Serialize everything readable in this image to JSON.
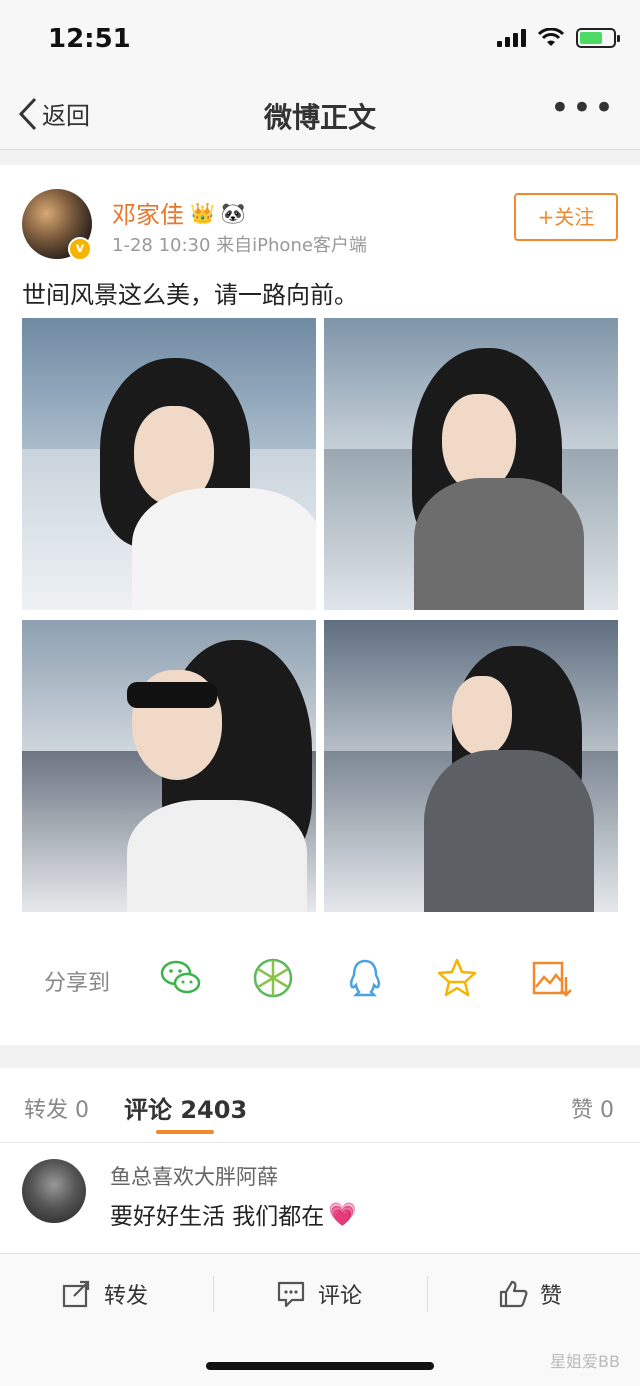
{
  "status_bar": {
    "time": "12:51"
  },
  "nav": {
    "back_label": "返回",
    "title": "微博正文",
    "more_label": "•••"
  },
  "post": {
    "author": "邓家佳",
    "badge_crown": "👑",
    "badge_panda": "🐼",
    "verified_mark": "v",
    "meta": "1-28 10:30  来自iPhone客户端",
    "follow_label": "+关注",
    "text": "世间风景这么美，请一路向前。"
  },
  "share": {
    "label": "分享到",
    "icons": [
      "wechat-icon",
      "moments-icon",
      "qq-icon",
      "qzone-icon",
      "save-image-icon"
    ]
  },
  "tabs": {
    "repost": "转发 0",
    "comments": "评论 2403",
    "likes": "赞 0"
  },
  "comment": {
    "name": "鱼总喜欢大胖阿薛",
    "text": "要好好生活 我们都在",
    "emoji": "💗"
  },
  "bottom": {
    "repost": "转发",
    "comment": "评论",
    "like": "赞",
    "watermark": "星姐爱BB"
  },
  "colors": {
    "accent": "#f08a2c",
    "username": "#e8772e",
    "wechat": "#3cb34a",
    "qq": "#4aa3e0",
    "star": "#f5b400"
  }
}
